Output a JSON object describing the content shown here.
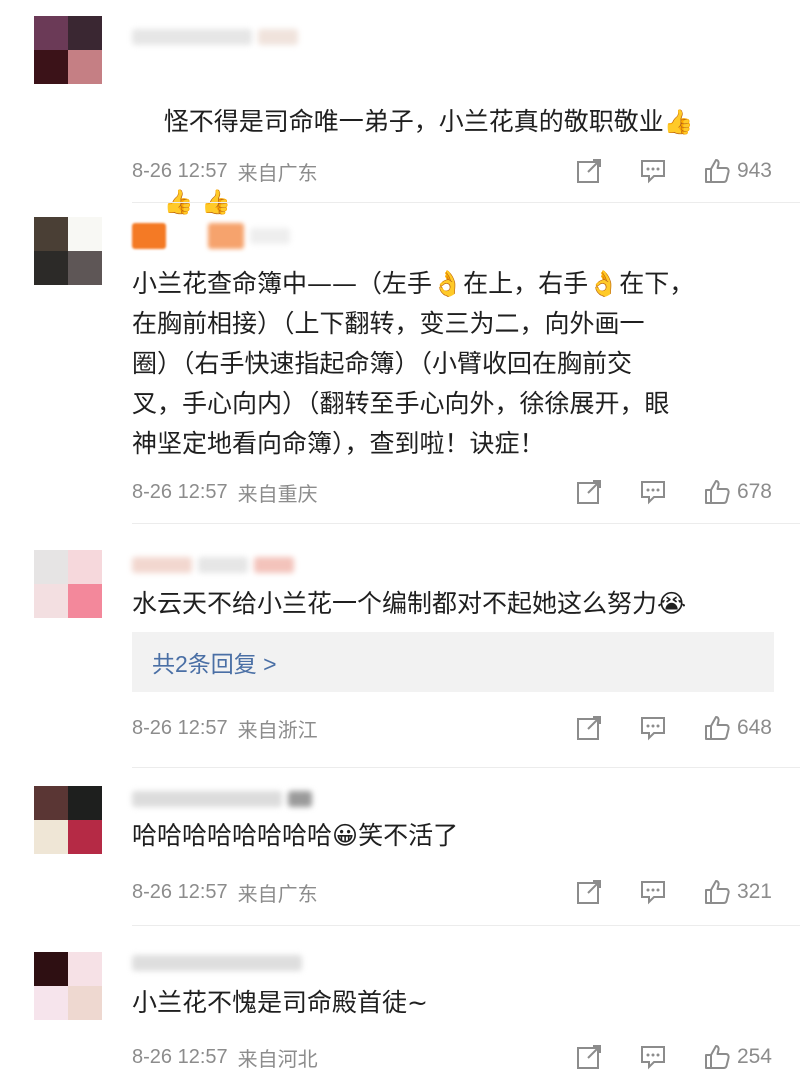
{
  "comments": [
    {
      "text_line1": "怪不得是司命唯一弟子，小兰花真的敬职敬业",
      "text_line1_emoji": "👍",
      "text_line2_emojis": "👍 👍",
      "time": "8-26 12:57",
      "location": "来自广东",
      "likes": "943",
      "avatar_colors": [
        "#6b3a57",
        "#3a2732",
        "#3b1218",
        "#c57f84",
        "#e6b9aa",
        "#b35f6a"
      ]
    },
    {
      "text": "小兰花查命簿中——（左手👌在上，右手👌在下，\n在胸前相接）（上下翻转，变三为二，向外画一\n圈）（右手快速指起命簿）（小臂收回在胸前交\n叉，手心向内）（翻转至手心向外，徐徐展开，眼\n神坚定地看向命簿），查到啦！诀症！",
      "time": "8-26 12:57",
      "location": "来自重庆",
      "likes": "678",
      "avatar_colors": [
        "#4a3f35",
        "#f8f8f4",
        "#2c2a28",
        "#5e5656"
      ]
    },
    {
      "text": "水云天不给小兰花一个编制都对不起她这么努力😭",
      "replies_label": "共2条回复 >",
      "time": "8-26 12:57",
      "location": "来自浙江",
      "likes": "648",
      "avatar_colors": [
        "#e6e4e4",
        "#f6d8dc",
        "#f3dfe1",
        "#f3889b"
      ]
    },
    {
      "text": "哈哈哈哈哈哈哈哈😀笑不活了",
      "time": "8-26 12:57",
      "location": "来自广东",
      "likes": "321",
      "avatar_colors": [
        "#5a3634",
        "#1e1f1e",
        "#efe6d6",
        "#b52a45"
      ]
    },
    {
      "text": "小兰花不愧是司命殿首徒~",
      "time": "8-26 12:57",
      "location": "来自河北",
      "likes": "254",
      "avatar_colors": [
        "#2e0f12",
        "#f6e1e6",
        "#f6e4ec",
        "#eed8d0"
      ]
    }
  ],
  "colors": {
    "meta_gray": "#8c8c8c",
    "link_blue": "#4a6fa5",
    "divider": "#ececec"
  },
  "icons": [
    "share-icon",
    "comment-icon",
    "thumbs-up-icon"
  ]
}
